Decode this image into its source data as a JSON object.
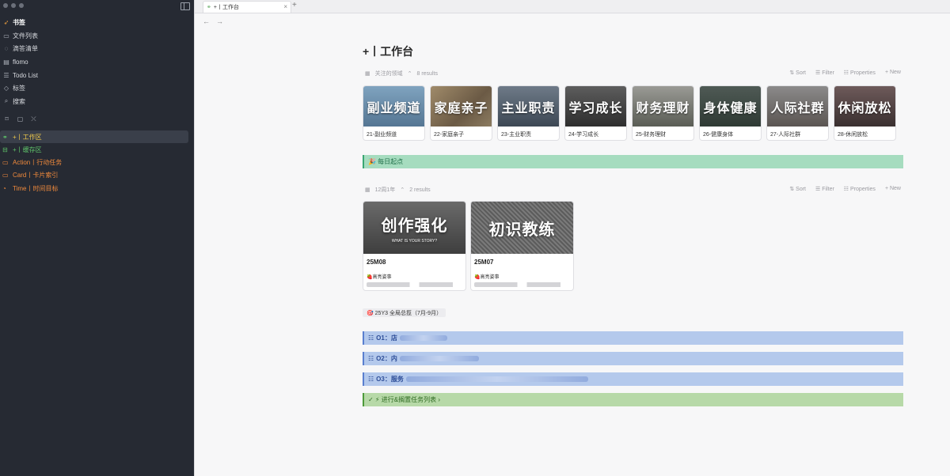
{
  "sidebar": {
    "nav": [
      {
        "label": "书签",
        "icon": "rocket-icon"
      },
      {
        "label": "文件列表",
        "icon": "folder-icon"
      },
      {
        "label": "滴答清单",
        "icon": "check-circle-icon"
      },
      {
        "label": "flomo",
        "icon": "memo-icon"
      },
      {
        "label": "Todo List",
        "icon": "list-icon"
      },
      {
        "label": "标签",
        "icon": "tag-icon"
      },
      {
        "label": "搜索",
        "icon": "search-icon"
      }
    ],
    "favorites": [
      {
        "label": "+丨工作区"
      },
      {
        "label": "+丨缓存区"
      },
      {
        "label": "Action丨行动任务"
      },
      {
        "label": "Card丨卡片索引"
      },
      {
        "label": "Time丨时间目标"
      }
    ]
  },
  "tabs": [
    {
      "label": "+丨工作台"
    }
  ],
  "page": {
    "title": "+丨工作台"
  },
  "view1": {
    "name": "关注的领域",
    "count": "8 results",
    "actions": {
      "sort": "Sort",
      "filter": "Filter",
      "properties": "Properties",
      "new": "New"
    },
    "cards": [
      {
        "image_text": "副业频道",
        "caption": "21-副业频道"
      },
      {
        "image_text": "家庭亲子",
        "caption": "22-家庭亲子"
      },
      {
        "image_text": "主业职责",
        "caption": "23-主业职责"
      },
      {
        "image_text": "学习成长",
        "caption": "24-学习成长"
      },
      {
        "image_text": "财务理财",
        "caption": "25-财务理财"
      },
      {
        "image_text": "身体健康",
        "caption": "26-健康身体"
      },
      {
        "image_text": "人际社群",
        "caption": "27-人际社群"
      },
      {
        "image_text": "休闲放松",
        "caption": "28-休闲放松"
      }
    ]
  },
  "callout_daily": {
    "text": "🎉 每日起点"
  },
  "view2": {
    "name": "12周1年",
    "count": "2 results",
    "actions": {
      "sort": "Sort",
      "filter": "Filter",
      "properties": "Properties",
      "new": "New"
    },
    "cards": [
      {
        "image_text": "创作强化",
        "image_sub": "WHAT IS YOUR STORY?",
        "name": "25M08",
        "tag": "🍓高亮姿事"
      },
      {
        "image_text": "初识教练",
        "image_sub": "",
        "name": "25M07",
        "tag": "🍓高亮姿事"
      }
    ]
  },
  "goal": {
    "label": "🎯 25Y3  全局总揽（7月-9月）"
  },
  "okrs": [
    {
      "label": "O1：店"
    },
    {
      "label": "O2：内"
    },
    {
      "label": "O3：服务"
    }
  ],
  "progress_callout": {
    "text": "✓ ⚡ 进行&搁置任务列表 ›"
  },
  "colors": {
    "sidebar_bg": "#262a33",
    "green_callout": "#a6dcbf",
    "blue_okr": "#b4c9ec",
    "progress_callout": "#b7d9a8"
  }
}
